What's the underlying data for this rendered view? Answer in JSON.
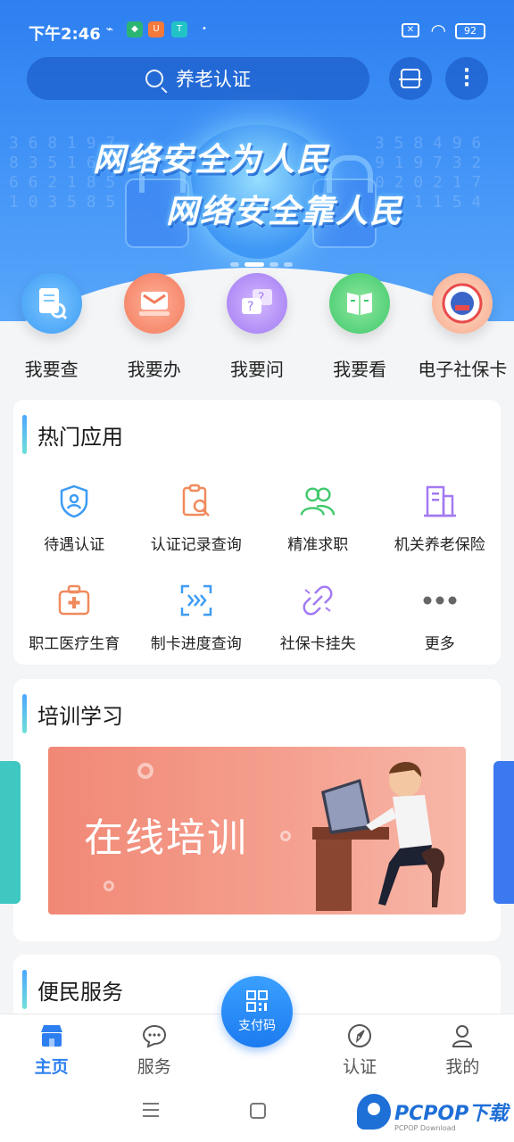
{
  "status_bar": {
    "time": "下午2:46",
    "battery": "92",
    "sim": "✕"
  },
  "search": {
    "placeholder": "养老认证"
  },
  "banner": {
    "slogan_1": "网络安全为人民",
    "slogan_2": "网络安全靠人民"
  },
  "quick_entries": [
    {
      "label": "我要查",
      "icon": "doc-search-icon",
      "color": "#3d9cf5"
    },
    {
      "label": "我要办",
      "icon": "envelope-icon",
      "color": "#f27a5b"
    },
    {
      "label": "我要问",
      "icon": "question-chat-icon",
      "color": "#a27af2"
    },
    {
      "label": "我要看",
      "icon": "book-icon",
      "color": "#3fc86a"
    },
    {
      "label": "电子社保卡",
      "icon": "social-security-badge-icon",
      "color": "#e94b4b"
    }
  ],
  "hot_apps": {
    "title": "热门应用",
    "items": [
      {
        "label": "待遇认证",
        "icon": "shield-person-icon"
      },
      {
        "label": "认证记录查询",
        "icon": "record-search-icon"
      },
      {
        "label": "精准求职",
        "icon": "people-icon"
      },
      {
        "label": "机关养老保险",
        "icon": "building-icon"
      },
      {
        "label": "职工医疗生育",
        "icon": "medical-kit-icon"
      },
      {
        "label": "制卡进度查询",
        "icon": "card-progress-icon"
      },
      {
        "label": "社保卡挂失",
        "icon": "broken-link-icon"
      },
      {
        "label": "更多",
        "icon": "more-dots-icon"
      }
    ]
  },
  "training": {
    "title": "培训学习",
    "banner_text": "在线培训"
  },
  "services": {
    "title": "便民服务"
  },
  "tabbar": {
    "items": [
      {
        "label": "主页",
        "icon": "store-icon",
        "active": true
      },
      {
        "label": "服务",
        "icon": "chat-bubble-icon",
        "active": false
      },
      {
        "label": "",
        "icon": "",
        "active": false
      },
      {
        "label": "认证",
        "icon": "compass-icon",
        "active": false
      },
      {
        "label": "我的",
        "icon": "user-icon",
        "active": false
      }
    ],
    "pay_label": "支付码"
  },
  "watermark": {
    "text": "PCPOP下载",
    "sub": "PCPOP Download"
  },
  "colors": {
    "primary": "#2d7ff0",
    "accent_bar": "#4aa6ff"
  }
}
